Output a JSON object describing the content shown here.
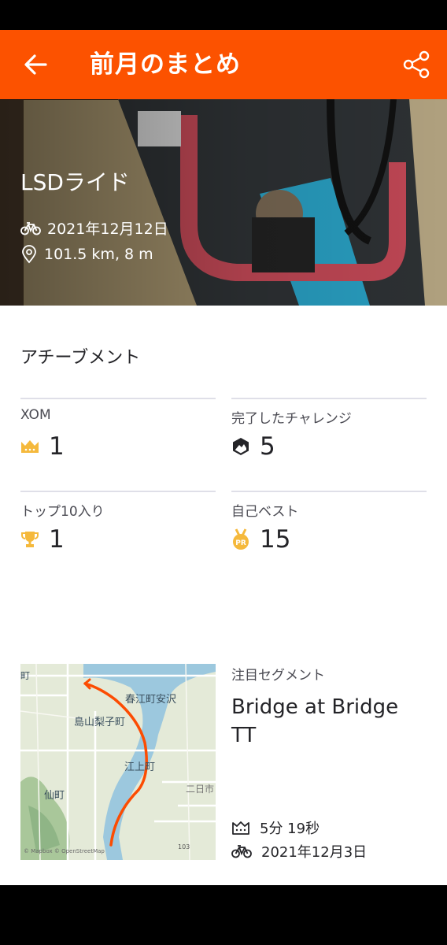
{
  "header": {
    "title": "前月のまとめ"
  },
  "hero": {
    "activity_name": "LSDライド",
    "date": "2021年12月12日",
    "stats": "101.5 km, 8 m"
  },
  "achievements": {
    "title": "アチーブメント",
    "tiles": [
      {
        "label": "XOM",
        "value": "1",
        "icon": "crown-icon"
      },
      {
        "label": "完了したチャレンジ",
        "value": "5",
        "icon": "challenge-icon"
      },
      {
        "label": "トップ10入り",
        "value": "1",
        "icon": "trophy-icon"
      },
      {
        "label": "自己ベスト",
        "value": "15",
        "icon": "pr-medal-icon"
      }
    ]
  },
  "segment": {
    "label": "注目セグメント",
    "name": "Bridge at Bridge TT",
    "time": "5分 19秒",
    "date": "2021年12月3日",
    "map": {
      "place_names": [
        "春江町安沢",
        "島山梨子町",
        "江上町",
        "仙町",
        "二日市",
        "町"
      ],
      "road_number": "103",
      "attribution": "© Mapbox © OpenStreetMap"
    }
  },
  "colors": {
    "brand": "#fc5200",
    "route": "#fc4c02",
    "gold": "#f5b93c"
  }
}
